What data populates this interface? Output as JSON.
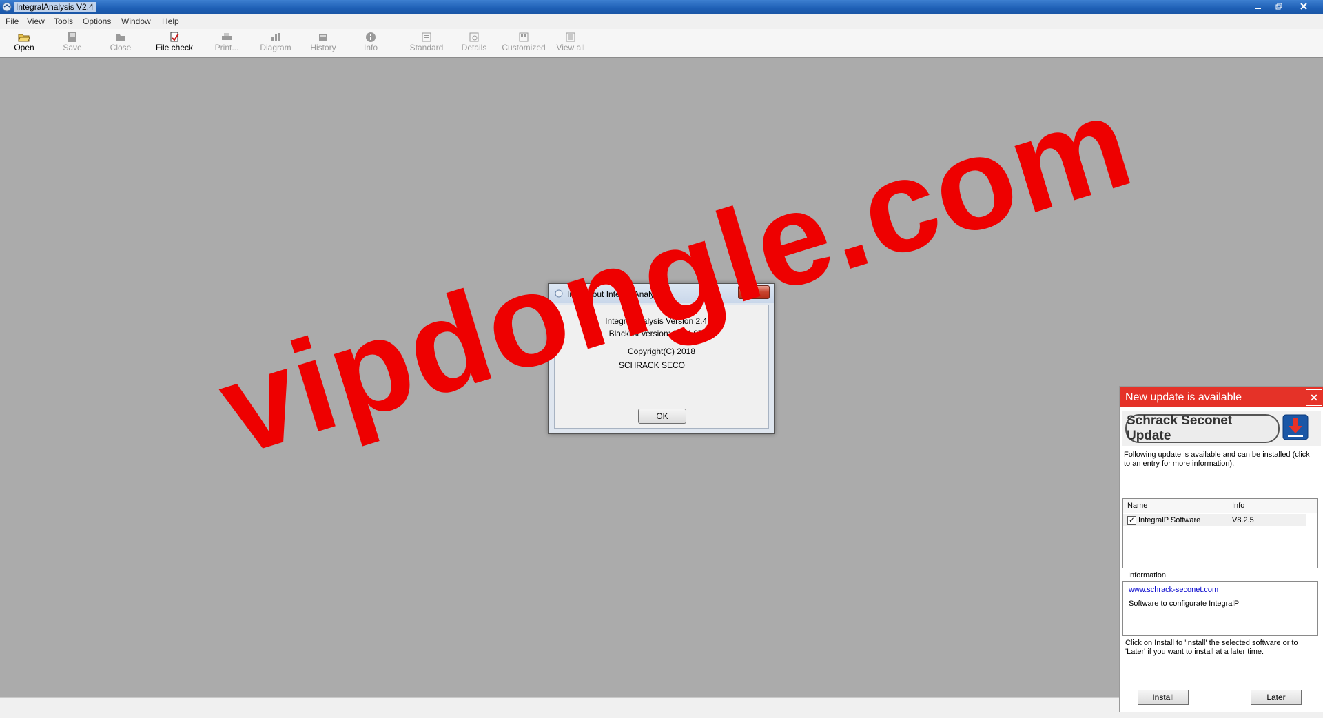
{
  "window": {
    "title": "IntegralAnalysis V2.4"
  },
  "menu": {
    "items": [
      "File",
      "View",
      "Tools",
      "Options",
      "Window",
      "Help"
    ]
  },
  "toolbar": {
    "buttons": [
      {
        "label": "Open",
        "icon": "open-folder-icon",
        "enabled": true
      },
      {
        "label": "Save",
        "icon": "save-icon",
        "enabled": false
      },
      {
        "label": "Close",
        "icon": "close-folder-icon",
        "enabled": false
      },
      {
        "label": "File check",
        "icon": "file-check-icon",
        "enabled": true
      },
      {
        "label": "Print...",
        "icon": "print-icon",
        "enabled": false
      },
      {
        "label": "Diagram",
        "icon": "diagram-icon",
        "enabled": false
      },
      {
        "label": "History",
        "icon": "history-icon",
        "enabled": false
      },
      {
        "label": "Info",
        "icon": "info-icon",
        "enabled": false
      },
      {
        "label": "Standard",
        "icon": "standard-view-icon",
        "enabled": false
      },
      {
        "label": "Details",
        "icon": "details-view-icon",
        "enabled": false
      },
      {
        "label": "Customized",
        "icon": "customized-view-icon",
        "enabled": false
      },
      {
        "label": "View all",
        "icon": "view-all-icon",
        "enabled": false
      }
    ]
  },
  "info_dialog": {
    "title": "Info about IntegralAnalysis",
    "version_line": "IntegralAnalysis Version 2.4.11",
    "blacklist_line": "Blacklist version: 2014.07.24",
    "copyright_line": "Copyright(C) 2018",
    "company_line": "SCHRACK SECO",
    "ok_label": "OK"
  },
  "update_panel": {
    "header": "New update is available",
    "logo_text": "Schrack Seconet Update",
    "intro": "Following update is available and can be installed (click to an entry for more information).",
    "table": {
      "columns": [
        "Name",
        "Info"
      ],
      "rows": [
        {
          "checked": true,
          "name": "IntegralP Software",
          "info": "V8.2.5"
        }
      ]
    },
    "information_label": "Information",
    "info_link": "www.schrack-seconet.com",
    "info_text": "Software to configurate IntegralP",
    "instructions": "Click on Install to 'install' the selected software or to 'Later' if you want to install at a later time.",
    "install_label": "Install",
    "later_label": "Later"
  },
  "watermark": {
    "text": "vipdongle.com"
  },
  "colors": {
    "update_header": "#e53228",
    "watermark": "#ee0000",
    "workspace": "#ababab"
  }
}
